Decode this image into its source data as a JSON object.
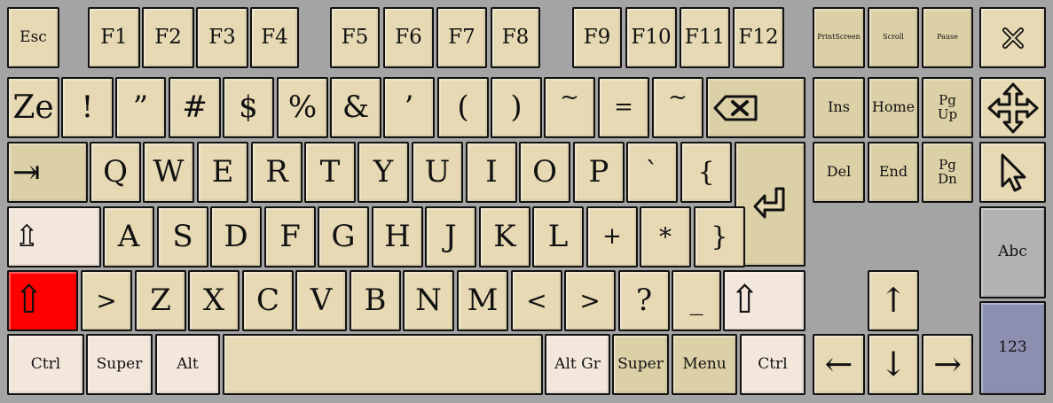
{
  "keyboard": {
    "fn_row": {
      "esc": "Esc",
      "f1": "F1",
      "f2": "F2",
      "f3": "F3",
      "f4": "F4",
      "f5": "F5",
      "f6": "F6",
      "f7": "F7",
      "f8": "F8",
      "f9": "F9",
      "f10": "F10",
      "f11": "F11",
      "f12": "F12",
      "print_screen": "PrintScreen",
      "scroll": "Scroll",
      "pause": "Pause",
      "close_icon": "close-icon"
    },
    "number_row": {
      "ze": "Ze",
      "k1": "!",
      "k2": "”",
      "k3": "#",
      "k4": "$",
      "k5": "%",
      "k6": "&",
      "k7": "’",
      "k8": "(",
      "k9": ")",
      "k10": "~",
      "k11": "=",
      "k12": "~",
      "backspace_icon": "backspace-icon",
      "ins": "Ins",
      "home": "Home",
      "pgup": "Pg\nUp",
      "move_icon": "move-arrows-icon"
    },
    "top_row": {
      "tab": "⇥",
      "q": "Q",
      "w": "W",
      "e": "E",
      "r": "R",
      "t": "T",
      "y": "Y",
      "u": "U",
      "i": "I",
      "o": "O",
      "p": "P",
      "grave": "`",
      "brace_open": "{",
      "enter_icon": "enter-icon",
      "del": "Del",
      "end": "End",
      "pgdn": "Pg\nDn",
      "pointer_icon": "pointer-icon"
    },
    "home_row": {
      "caps": "⇫",
      "a": "A",
      "s": "S",
      "d": "D",
      "f": "F",
      "g": "G",
      "h": "H",
      "j": "J",
      "k": "K",
      "l": "L",
      "plus": "+",
      "star": "*",
      "brace_close": "}",
      "abc": "Abc"
    },
    "bottom_row": {
      "shift_left": "⇧",
      "gt": ">",
      "z": "Z",
      "x": "X",
      "c": "C",
      "v": "V",
      "b": "B",
      "n": "N",
      "m": "M",
      "lt": "<",
      "gt2": ">",
      "question": "?",
      "underscore": "_",
      "shift_right": "⇧",
      "up": "↑"
    },
    "space_row": {
      "ctrl_left": "Ctrl",
      "super_left": "Super",
      "alt": "Alt",
      "space": "",
      "altgr": "Alt Gr",
      "super_right": "Super",
      "menu": "Menu",
      "ctrl_right": "Ctrl",
      "left": "←",
      "down": "↓",
      "right": "→",
      "num": "123"
    },
    "colors": {
      "background": "#a4a4a4",
      "key": "#e6d9b4",
      "key_alt": "#dcd0a6",
      "modifier": "#f3e6db",
      "active_shift": "#ff0000",
      "abc_key": "#b2b2b2",
      "num_key": "#8c8fb0"
    }
  }
}
